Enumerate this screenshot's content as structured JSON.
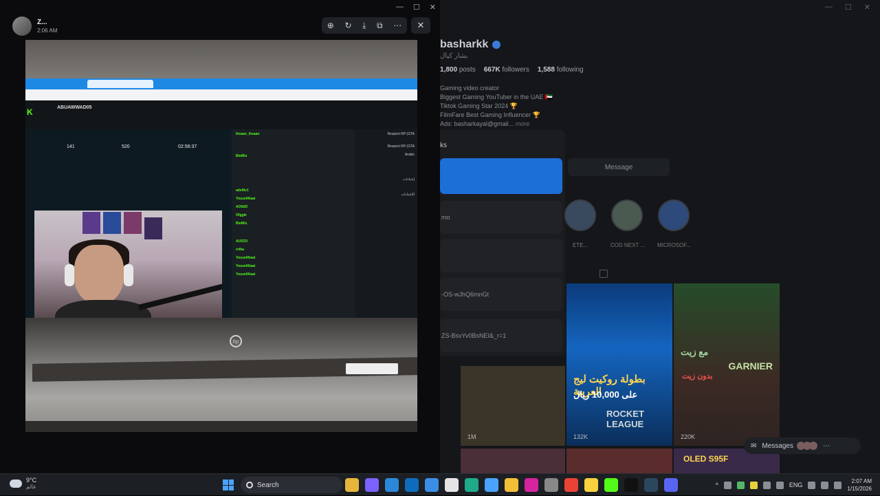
{
  "viewer": {
    "sender_name": "Z...",
    "sender_time": "2:06 AM",
    "tools": [
      "zoom-in",
      "rotate",
      "download",
      "open-external",
      "more"
    ],
    "close": "✕"
  },
  "window_controls": [
    "—",
    "☐",
    "✕"
  ],
  "photo": {
    "channel_name": "ABUAWWAD05",
    "stats": [
      "141",
      "520",
      "02:56:37"
    ],
    "chat_users": [
      "ihsaan_ihsaan",
      "BioMix",
      "adelfiv1",
      "YousefAlaai",
      "AONZII",
      "Ofggle",
      "BioMix",
      "AUXZU",
      "refka",
      "YousefAlaai",
      "YousefAlaai",
      "YousefAlaai"
    ],
    "right_panel": [
      "Respect RP (GTA",
      "Respect RP (GTA",
      "Arabic",
      "إعدادات",
      "الإعدادات"
    ],
    "hp_logo": "hp"
  },
  "profile": {
    "username": "basharkk",
    "subname": "بشار كيال",
    "posts": "1,800",
    "posts_label": "posts",
    "followers": "667K",
    "followers_label": "followers",
    "following": "1,588",
    "following_label": "following",
    "bio": [
      "Gaming video creator",
      "Biggest Gaming YouTuber in the UAE 🇦🇪",
      "Tiktok Gaming Star 2024 🏆",
      "FilmFare Best Gaming Influencer 🏆"
    ],
    "ads": "Ads: basharkayal@gmail...",
    "more": "more",
    "message_btn": "Message"
  },
  "dropdown": {
    "title": "ks",
    "items": [
      "mo",
      "",
      "-OS-wJhQ6mnGt",
      "ZS-BsvYv0BsNEI&_r=1"
    ]
  },
  "highlights": [
    "ETE...",
    "COD NEXT ...",
    "MICROSOF..."
  ],
  "grid": {
    "tiles": [
      {
        "views": "1M"
      },
      {
        "views": "132K",
        "arabic": "بطولة روكيت ليج العربية",
        "prize": "على 10,000 ريال",
        "brand": "ROCKET LEAGUE"
      },
      {
        "views": "220K",
        "arabic": "مع زيت",
        "brand": "GARNIER",
        "arabic2": "بدون زيت"
      },
      {
        "brand": "OLED S95F"
      }
    ]
  },
  "messages_pill": "Messages",
  "taskbar": {
    "temp": "9°C",
    "weather_sub": "غائم",
    "search": "Search",
    "lang": "ENG",
    "time": "2:07 AM",
    "date": "1/15/2026",
    "apps": [
      {
        "name": "files-icon",
        "color": "#e8b53c"
      },
      {
        "name": "copilot-icon",
        "color": "#7b61ff"
      },
      {
        "name": "store-icon",
        "color": "#2b88d8"
      },
      {
        "name": "outlook-icon",
        "color": "#0f6cbd"
      },
      {
        "name": "mail-icon",
        "color": "#3b8ee6"
      },
      {
        "name": "chatgpt-icon",
        "color": "#e5e5e5"
      },
      {
        "name": "edge-icon",
        "color": "#1faa8a"
      },
      {
        "name": "sheets-icon",
        "color": "#4aa3ff"
      },
      {
        "name": "folder-icon",
        "color": "#f2c037"
      },
      {
        "name": "instagram-icon",
        "color": "#d6249f"
      },
      {
        "name": "camera-icon",
        "color": "#888888"
      },
      {
        "name": "chrome-icon",
        "color": "#ea4335"
      },
      {
        "name": "notes-icon",
        "color": "#f7d23e"
      },
      {
        "name": "kick-icon",
        "color": "#53fc18"
      },
      {
        "name": "tiktok-icon",
        "color": "#111111"
      },
      {
        "name": "steam-icon",
        "color": "#2a475e"
      },
      {
        "name": "discord-icon",
        "color": "#5865f2"
      }
    ]
  }
}
